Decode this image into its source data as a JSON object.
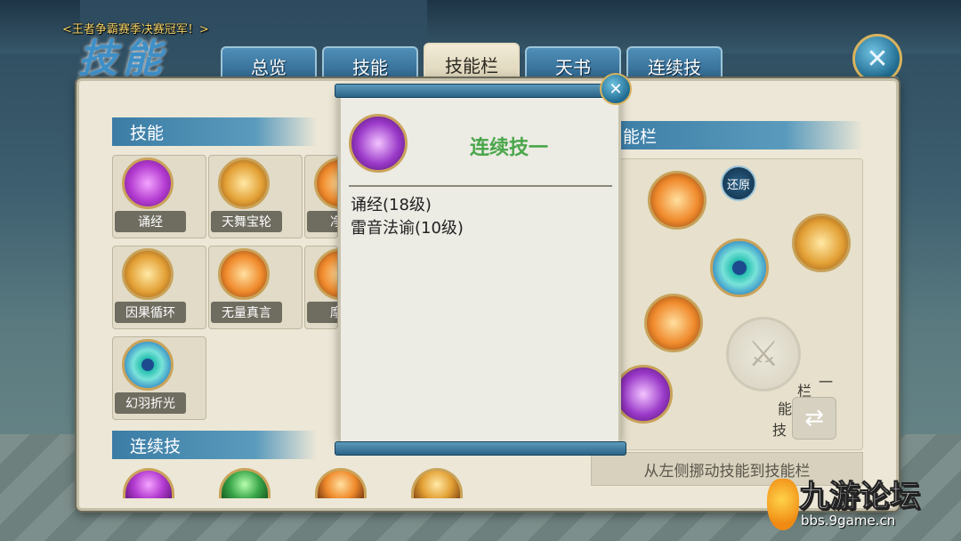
{
  "ticker": "<王者争霸赛季决赛冠军！>",
  "title": "技能",
  "tabs": [
    {
      "label": "总览",
      "active": false
    },
    {
      "label": "技能",
      "active": false
    },
    {
      "label": "技能栏",
      "active": true
    },
    {
      "label": "天书",
      "active": false
    },
    {
      "label": "连续技",
      "active": false
    }
  ],
  "close_icon": "close-icon",
  "sections": {
    "skills": "技能",
    "combos": "连续技",
    "skill_bar": "能栏"
  },
  "skills": [
    {
      "label": "诵经",
      "icon": "purple-rune-icon"
    },
    {
      "label": "天舞宝轮",
      "icon": "golden-wheel-icon"
    },
    {
      "label": "净土",
      "icon": "orange-hand-icon"
    },
    {
      "label": "因果循环",
      "icon": "gold-flame-icon"
    },
    {
      "label": "无量真言",
      "icon": "golden-buddha-icon"
    },
    {
      "label": "摩诃",
      "icon": "fire-burst-icon"
    },
    {
      "label": "幻羽折光",
      "icon": "peacock-feather-icon"
    }
  ],
  "popup": {
    "title": "连续技一",
    "lines": [
      "诵经(18级)",
      "雷音法谕(10级)"
    ]
  },
  "skill_bar": {
    "restore_label": "还原",
    "switch_label_chars": [
      "栏",
      "一",
      "能",
      "技"
    ],
    "hint": "从左侧挪动技能到技能栏"
  },
  "watermark": {
    "text": "九游论坛",
    "url": "bbs.9game.cn"
  }
}
